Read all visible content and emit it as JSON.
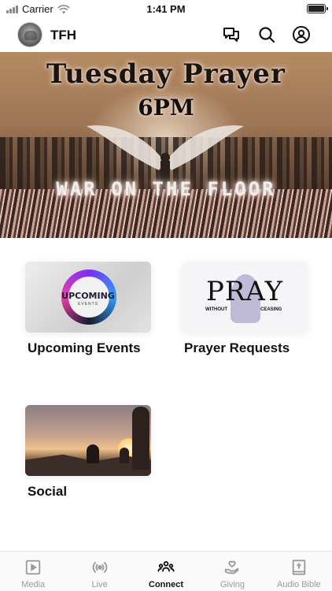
{
  "status_bar": {
    "carrier": "Carrier",
    "time": "1:41 PM"
  },
  "header": {
    "title": "TFH",
    "icons": [
      "chat-icon",
      "search-icon",
      "account-icon"
    ]
  },
  "banner": {
    "title": "Tuesday Prayer",
    "time": "6PM",
    "subtitle": "WAR ON THE FLOOR"
  },
  "cards": [
    {
      "label": "Upcoming Events",
      "thumb_text": "UPCOMING",
      "thumb_subtext": "EVENTS"
    },
    {
      "label": "Prayer Requests",
      "thumb_text": "PRAY",
      "thumb_subtext_left": "WITHOUT",
      "thumb_subtext_right": "CEASING"
    },
    {
      "label": "Social"
    }
  ],
  "tabs": [
    {
      "label": "Media",
      "icon": "play-square-icon",
      "active": false
    },
    {
      "label": "Live",
      "icon": "broadcast-icon",
      "active": false
    },
    {
      "label": "Connect",
      "icon": "group-icon",
      "active": true
    },
    {
      "label": "Giving",
      "icon": "heart-hand-icon",
      "active": false
    },
    {
      "label": "Audio Bible",
      "icon": "bible-icon",
      "active": false
    }
  ],
  "colors": {
    "active_tab": "#111111",
    "inactive_tab": "#9a9a9a"
  }
}
